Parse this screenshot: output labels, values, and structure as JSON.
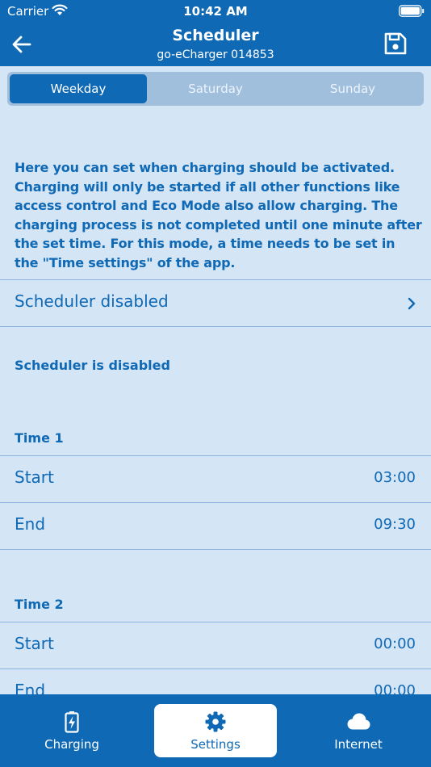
{
  "status_bar": {
    "carrier": "Carrier",
    "time": "10:42 AM"
  },
  "header": {
    "title": "Scheduler",
    "subtitle": "go-eCharger 014853"
  },
  "segments": [
    "Weekday",
    "Saturday",
    "Sunday"
  ],
  "selected_segment": "Weekday",
  "info_text": "Here you can set when charging should be activated. Charging will only be started if all other functions like access control and Eco Mode also allow charging. The charging process is not completed until one minute after the set time. For this mode, a time needs to be set in the \"Time settings\" of the app.",
  "scheduler_row": {
    "label": "Scheduler disabled"
  },
  "scheduler_status": "Scheduler is disabled",
  "times": [
    {
      "title": "Time 1",
      "start_label": "Start",
      "start_value": "03:00",
      "end_label": "End",
      "end_value": "09:30"
    },
    {
      "title": "Time 2",
      "start_label": "Start",
      "start_value": "00:00",
      "end_label": "End",
      "end_value": "00:00"
    }
  ],
  "tabs": [
    {
      "label": "Charging",
      "icon": "battery-charging-icon"
    },
    {
      "label": "Settings",
      "icon": "gear-icon"
    },
    {
      "label": "Internet",
      "icon": "cloud-icon"
    }
  ],
  "active_tab": "Settings",
  "colors": {
    "primary": "#0f69b4",
    "background": "#d4e5f6",
    "segment_bg": "#9fbfdd"
  }
}
